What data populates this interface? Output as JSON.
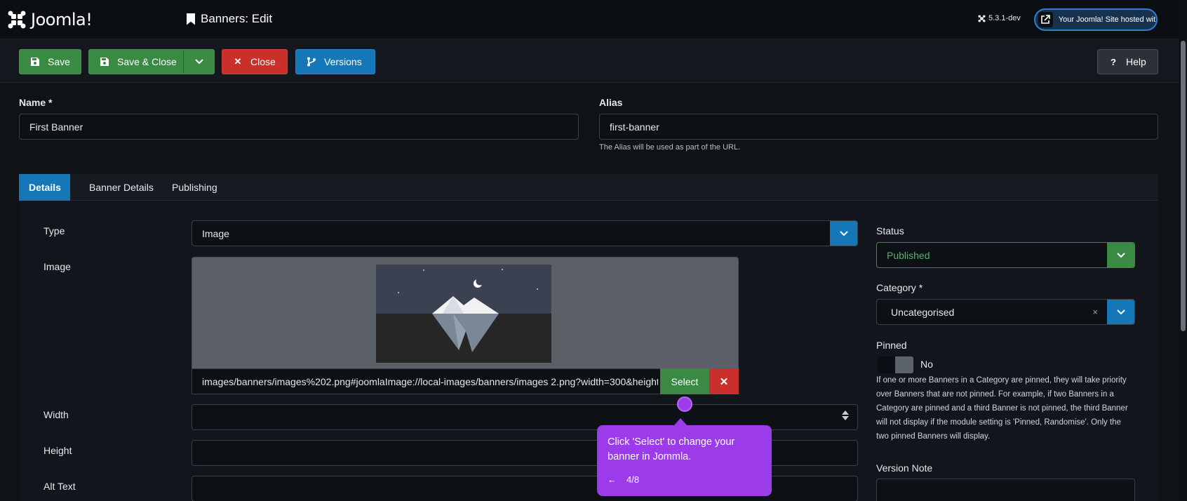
{
  "header": {
    "brand": "Joomla!",
    "page_title": "Banners: Edit",
    "version": "5.3.1-dev",
    "site_link": "Your Joomla! Site hosted wit..."
  },
  "toolbar": {
    "save": "Save",
    "save_close": "Save & Close",
    "close": "Close",
    "versions": "Versions",
    "help": "Help"
  },
  "form": {
    "name_label": "Name *",
    "name_value": "First Banner",
    "alias_label": "Alias",
    "alias_value": "first-banner",
    "alias_help": "The Alias will be used as part of the URL."
  },
  "tabs": [
    "Details",
    "Banner Details",
    "Publishing"
  ],
  "details": {
    "type_label": "Type",
    "type_value": "Image",
    "image_label": "Image",
    "image_path": "images/banners/images%202.png#joomlaImage://local-images/banners/images 2.png?width=300&height=168",
    "select_label": "Select",
    "clear_label": "✕",
    "width_label": "Width",
    "height_label": "Height",
    "alt_label": "Alt Text"
  },
  "sidebar": {
    "status_label": "Status",
    "status_value": "Published",
    "category_label": "Category *",
    "category_value": "Uncategorised",
    "category_clear": "×",
    "pinned_label": "Pinned",
    "pinned_value": "No",
    "pinned_help": "If one or more Banners in a Category are pinned, they will take priority over Banners that are not pinned. For example, if two Banners in a Category are pinned and a third Banner is not pinned, the third Banner will not display if the module setting is 'Pinned, Randomise'. Only the two pinned Banners will display.",
    "version_note_label": "Version Note"
  },
  "tooltip": {
    "text": "Click 'Select' to change your banner in Jommla.",
    "back": "←",
    "progress": "4/8"
  },
  "colors": {
    "green": "#3a8a44",
    "red": "#c9302c",
    "blue": "#1677b8",
    "purple": "#9b3bea"
  }
}
